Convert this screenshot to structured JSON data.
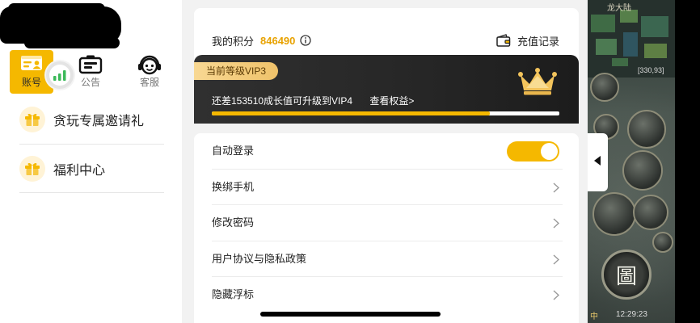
{
  "colors": {
    "accent": "#F5B800",
    "points_value": "#E8A200",
    "vip_badge": "#EFC26A",
    "vip_card": "#262626",
    "page_bg": "#F2F2F2"
  },
  "left_panel": {
    "tabs": [
      {
        "label": "账号",
        "icon": "account-card-icon",
        "selected": true
      },
      {
        "label": "公告",
        "icon": "notice-board-icon",
        "selected": false
      },
      {
        "label": "客服",
        "icon": "customer-service-icon",
        "selected": false
      }
    ],
    "floating_ball_icon": "signal-bars-icon",
    "menu": [
      {
        "label": "贪玩专属邀请礼",
        "icon": "gift-icon"
      },
      {
        "label": "福利中心",
        "icon": "gift-icon"
      }
    ]
  },
  "points": {
    "label": "我的积分",
    "value": "846490",
    "info_icon": "info-icon",
    "recharge_label": "充值记录",
    "recharge_icon": "wallet-icon"
  },
  "vip": {
    "level_badge": "当前等级VIP3",
    "upgrade_text": "还差153510成长值可升级到VIP4",
    "benefits_link": "查看权益>",
    "progress": 0.8,
    "icon": "crown-icon"
  },
  "settings": {
    "rows": [
      {
        "label": "自动登录",
        "toggle_on": true
      },
      {
        "label": "换绑手机",
        "icon": "chevron-right-icon"
      },
      {
        "label": "修改密码",
        "icon": "chevron-right-icon"
      },
      {
        "label": "用户协议与隐私政策",
        "icon": "chevron-right-icon"
      },
      {
        "label": "隐藏浮标",
        "icon": "chevron-right-icon"
      }
    ]
  },
  "panel_handle_icon": "collapse-left-icon",
  "game": {
    "map_name": "龙大陆",
    "coordinates": "[330,93]",
    "seal_glyph": "圖",
    "channel_tab": "中",
    "clock": "12:29:23"
  }
}
